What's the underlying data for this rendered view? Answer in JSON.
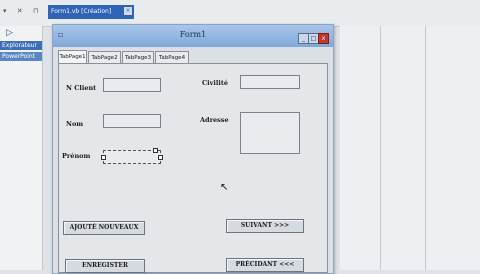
{
  "ide": {
    "tab_title": "Form1.vb [Création]",
    "tab_close": "×",
    "toolbar_glyphs": "▾ ✕ ⊓",
    "left_panel": {
      "play_icon": "▷",
      "items": [
        "Explorateur",
        "PowerPoint"
      ]
    }
  },
  "form": {
    "title": "Form1",
    "icon": "▫",
    "controls": {
      "minimize": "_",
      "maximize": "□",
      "close": "x"
    },
    "tabs": [
      "TabPage1",
      "TabPage2",
      "TabPage3",
      "TabPage4"
    ],
    "labels": {
      "client": "N Client",
      "nom": "Nom",
      "prenom": "Prénom",
      "civilite": "Civilité",
      "adresse": "Adresse"
    },
    "buttons": {
      "add_new": "AJOUTÉ NOUVEAUX",
      "next": "SUIVANT >>>",
      "save": "ENREGISTER",
      "previous": "PRÉCIDANT <<<"
    }
  },
  "cursor_icon": "↖"
}
